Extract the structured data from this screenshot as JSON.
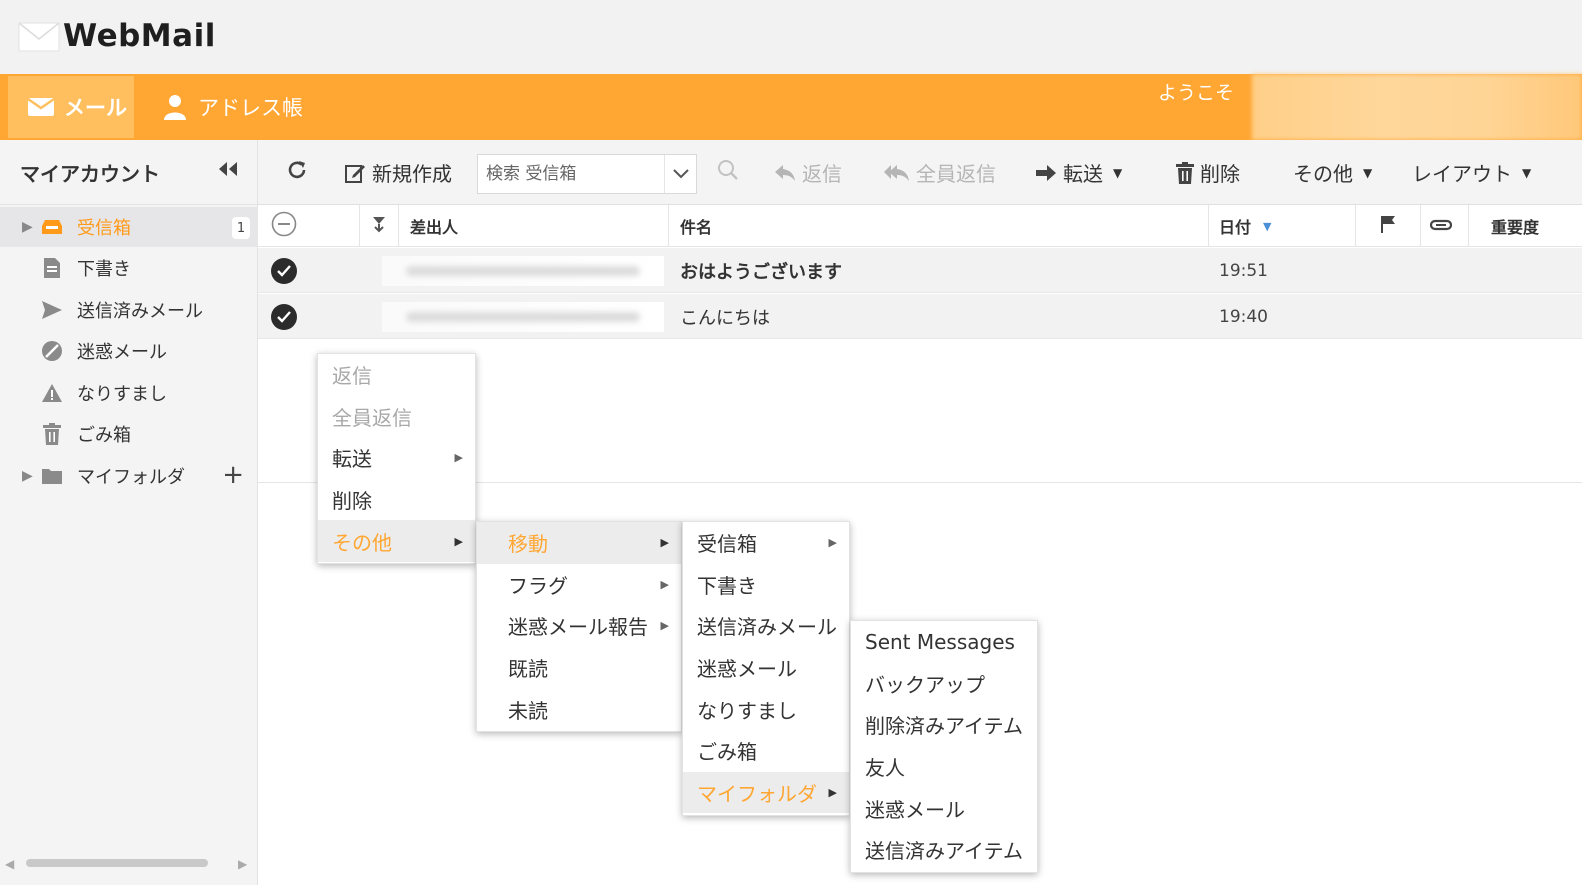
{
  "app": {
    "logo_text": "WebMail"
  },
  "nav": {
    "tabs": [
      {
        "label": "メール",
        "icon": "envelope-icon",
        "active": true
      },
      {
        "label": "アドレス帳",
        "icon": "person-icon",
        "active": false
      }
    ],
    "welcome": "ようこそ"
  },
  "sidebar": {
    "title": "マイアカウント",
    "folders": [
      {
        "label": "受信箱",
        "icon": "inbox-icon",
        "badge": "1",
        "active": true
      },
      {
        "label": "下書き",
        "icon": "draft-icon"
      },
      {
        "label": "送信済みメール",
        "icon": "send-icon"
      },
      {
        "label": "迷惑メール",
        "icon": "spam-icon"
      },
      {
        "label": "なりすまし",
        "icon": "warning-icon"
      },
      {
        "label": "ごみ箱",
        "icon": "trash-icon"
      },
      {
        "label": "マイフォルダ",
        "icon": "folder-icon"
      }
    ]
  },
  "toolbar": {
    "compose": "新規作成",
    "search_placeholder": "検索 受信箱",
    "reply": "返信",
    "reply_all": "全員返信",
    "forward": "転送",
    "delete": "削除",
    "other": "その他",
    "layout": "レイアウト"
  },
  "list": {
    "columns": {
      "from": "差出人",
      "subject": "件名",
      "date": "日付",
      "importance": "重要度"
    },
    "rows": [
      {
        "subject": "おはようございます",
        "date": "19:51",
        "bold": true
      },
      {
        "subject": "こんにちは",
        "date": "19:40",
        "bold": false
      }
    ]
  },
  "context_menu": {
    "level1": [
      "返信",
      "全員返信",
      "転送",
      "削除",
      "その他"
    ],
    "level2": [
      "移動",
      "フラグ",
      "迷惑メール報告",
      "既読",
      "未読"
    ],
    "level3": [
      "受信箱",
      "下書き",
      "送信済みメール",
      "迷惑メール",
      "なりすまし",
      "ごみ箱",
      "マイフォルダ"
    ],
    "level4": [
      "Sent Messages",
      "バックアップ",
      "削除済みアイテム",
      "友人",
      "迷惑メール",
      "送信済みアイテム"
    ]
  },
  "colors": {
    "accent": "#ffa633",
    "accent_light": "#ffbf5f"
  }
}
